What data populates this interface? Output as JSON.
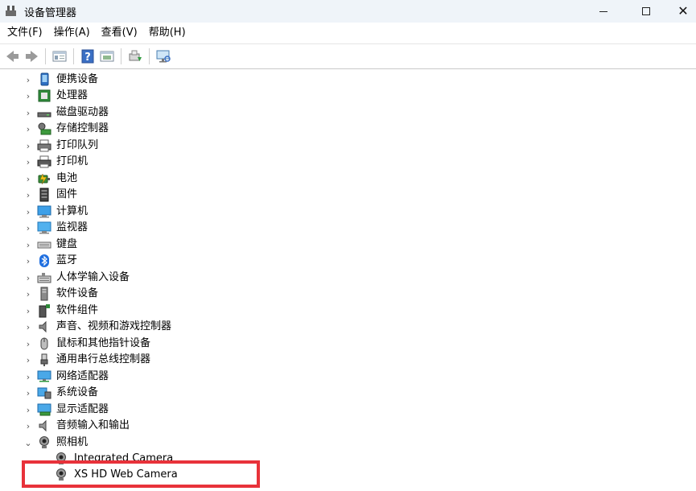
{
  "window": {
    "title": "设备管理器",
    "controls": {
      "minimize": "—",
      "close": "✕"
    }
  },
  "menu": [
    {
      "label": "文件(F)"
    },
    {
      "label": "操作(A)"
    },
    {
      "label": "查看(V)"
    },
    {
      "label": "帮助(H)"
    }
  ],
  "toolbar": {
    "buttons": [
      "back-icon",
      "forward-icon",
      "properties-pane-icon",
      "help-icon",
      "show-hidden-icon",
      "update-driver-icon",
      "scan-hardware-icon"
    ]
  },
  "tree": {
    "categories": [
      {
        "label": "便携设备",
        "icon": "portable-device-icon",
        "expanded": false
      },
      {
        "label": "处理器",
        "icon": "processor-icon",
        "expanded": false
      },
      {
        "label": "磁盘驱动器",
        "icon": "disk-drive-icon",
        "expanded": false
      },
      {
        "label": "存储控制器",
        "icon": "storage-controller-icon",
        "expanded": false
      },
      {
        "label": "打印队列",
        "icon": "print-queue-icon",
        "expanded": false
      },
      {
        "label": "打印机",
        "icon": "printer-icon",
        "expanded": false
      },
      {
        "label": "电池",
        "icon": "battery-icon",
        "expanded": false
      },
      {
        "label": "固件",
        "icon": "firmware-icon",
        "expanded": false
      },
      {
        "label": "计算机",
        "icon": "computer-icon",
        "expanded": false
      },
      {
        "label": "监视器",
        "icon": "monitor-icon",
        "expanded": false
      },
      {
        "label": "键盘",
        "icon": "keyboard-icon",
        "expanded": false
      },
      {
        "label": "蓝牙",
        "icon": "bluetooth-icon",
        "expanded": false
      },
      {
        "label": "人体学输入设备",
        "icon": "hid-icon",
        "expanded": false
      },
      {
        "label": "软件设备",
        "icon": "software-device-icon",
        "expanded": false
      },
      {
        "label": "软件组件",
        "icon": "software-component-icon",
        "expanded": false
      },
      {
        "label": "声音、视频和游戏控制器",
        "icon": "sound-icon",
        "expanded": false
      },
      {
        "label": "鼠标和其他指针设备",
        "icon": "mouse-icon",
        "expanded": false
      },
      {
        "label": "通用串行总线控制器",
        "icon": "usb-icon",
        "expanded": false
      },
      {
        "label": "网络适配器",
        "icon": "network-adapter-icon",
        "expanded": false
      },
      {
        "label": "系统设备",
        "icon": "system-device-icon",
        "expanded": false
      },
      {
        "label": "显示适配器",
        "icon": "display-adapter-icon",
        "expanded": false
      },
      {
        "label": "音频输入和输出",
        "icon": "audio-io-icon",
        "expanded": false
      },
      {
        "label": "照相机",
        "icon": "camera-icon",
        "expanded": true,
        "children": [
          {
            "label": "Integrated Camera",
            "icon": "webcam-icon"
          },
          {
            "label": "XS HD Web Camera",
            "icon": "webcam-icon",
            "highlighted": true
          }
        ]
      }
    ]
  },
  "colors": {
    "titlebar_bg": "#eff4f9",
    "highlight_border": "#e8323a"
  }
}
